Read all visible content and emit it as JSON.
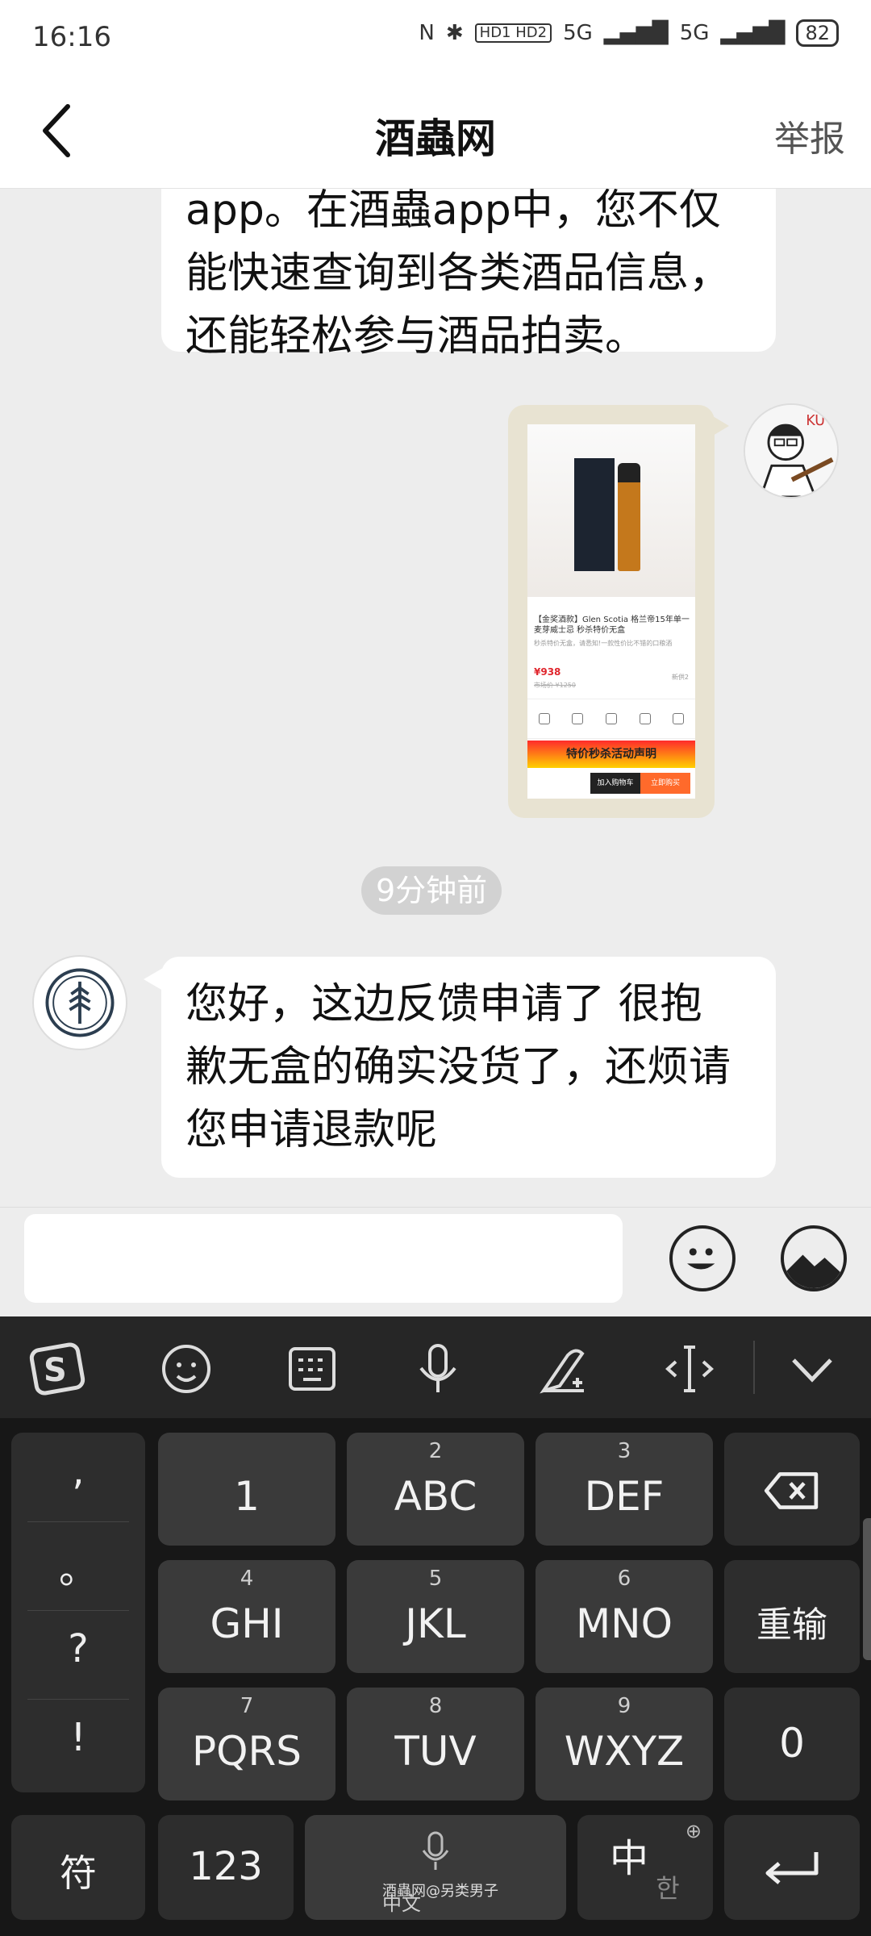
{
  "status_bar": {
    "time": "16:16",
    "network_chip": "HD1 HD2",
    "signal1": "5G",
    "signal2": "5G",
    "battery": "82"
  },
  "header": {
    "title": "酒蟲网",
    "report": "举报"
  },
  "messages": [
    {
      "from": "shop",
      "lines": [
        "app。在酒蟲app中，您不仅",
        "能快速查询到各类酒品信息，",
        "还能轻松参与酒品拍卖。"
      ]
    },
    {
      "from": "user",
      "type": "image",
      "image": {
        "product_title": "【金奖酒款】Glen Scotia 格兰帝15年单一麦芽威士忌 秒杀特价无盒",
        "product_sub": "秒杀特价无盒，请悉知!一款性价比不错的口粮酒",
        "price": "¥938",
        "orig_price": "市场价 ¥1250",
        "sold": "新供2",
        "banner": "特价秒杀活动声明",
        "add_cart": "加入购物车",
        "buy_now": "立即购买"
      }
    },
    {
      "type": "timestamp",
      "text": "9分钟前"
    },
    {
      "from": "shop",
      "lines": [
        "您好，这边反馈申请了 很抱",
        "歉无盒的确实没货了，还烦请",
        "您申请退款呢"
      ]
    }
  ],
  "input": {
    "placeholder": ""
  },
  "keyboard": {
    "punct": [
      ",",
      "。",
      "?",
      "!"
    ],
    "keys": [
      {
        "num": "",
        "label": "1"
      },
      {
        "num": "2",
        "label": "ABC"
      },
      {
        "num": "3",
        "label": "DEF"
      },
      {
        "num": "4",
        "label": "GHI"
      },
      {
        "num": "5",
        "label": "JKL"
      },
      {
        "num": "6",
        "label": "MNO"
      },
      {
        "num": "7",
        "label": "PQRS"
      },
      {
        "num": "8",
        "label": "TUV"
      },
      {
        "num": "9",
        "label": "WXYZ"
      }
    ],
    "retype": "重输",
    "zero": "0",
    "symbol": "符",
    "num123": "123",
    "space_sub": "中文",
    "lang_main": "中",
    "lang_alt": "한",
    "watermark": "酒蟲网@另类男子"
  }
}
